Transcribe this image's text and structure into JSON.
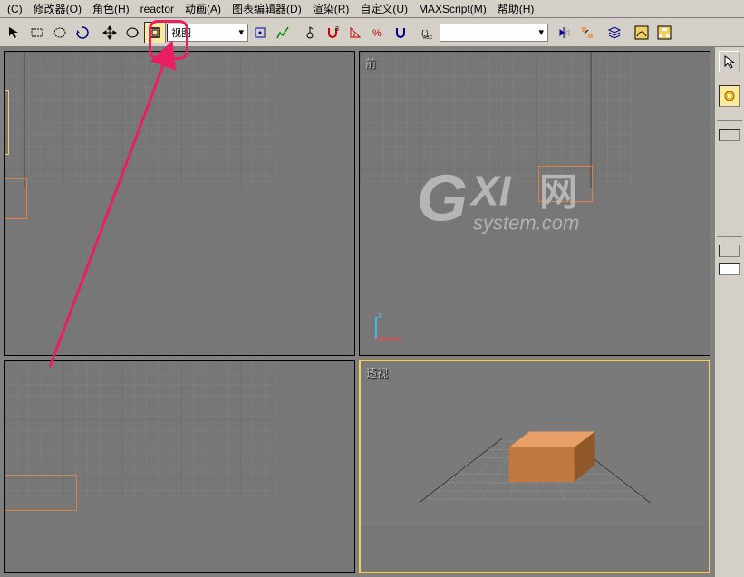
{
  "menu": {
    "c": "(C)",
    "modifier": "修改器(O)",
    "character": "角色(H)",
    "reactor": "reactor",
    "animation": "动画(A)",
    "grapheditor": "图表编辑器(D)",
    "render": "渲染(R)",
    "customize": "自定义(U)",
    "maxscript": "MAXScript(M)",
    "help": "帮助(H)"
  },
  "toolbar": {
    "view_dropdown": "视图"
  },
  "viewports": {
    "front": "前",
    "perspective": "透视"
  },
  "watermark": {
    "g": "G",
    "xi": "XI",
    "wang": "网",
    "sys": "system.com"
  }
}
